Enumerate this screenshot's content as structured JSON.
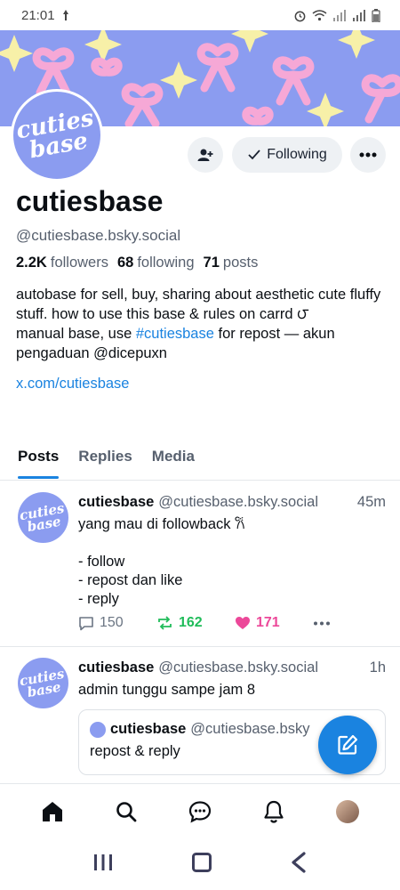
{
  "status_bar": {
    "time": "21:01"
  },
  "profile": {
    "avatar_text_line1": "cuties",
    "avatar_text_line2": "base",
    "display_name": "cutiesbase",
    "handle": "@cutiesbase.bsky.social",
    "followers_count": "2.2K",
    "followers_label": "followers",
    "following_count": "68",
    "following_label": "following",
    "posts_count": "71",
    "posts_label": "posts",
    "bio_line1": "autobase for sell, buy, sharing about aesthetic cute fluffy stuff. how to use this base & rules on carrd ౮",
    "bio_line2_prefix": "manual base, use ",
    "bio_hashtag": "#cutiesbase",
    "bio_line2_suffix": " for repost —  akun pengaduan @dicepuxn",
    "bio_link": "x.com/cutiesbase"
  },
  "actions": {
    "following_label": "Following"
  },
  "tabs": [
    {
      "label": "Posts",
      "active": true
    },
    {
      "label": "Replies",
      "active": false
    },
    {
      "label": "Media",
      "active": false
    }
  ],
  "posts": [
    {
      "name": "cutiesbase",
      "handle": "@cutiesbase.bsky.social",
      "time": "45m",
      "text_line1": "yang mau di followback 𐙚",
      "text_line2": "",
      "text_line3": "- follow",
      "text_line4": "- repost dan like",
      "text_line5": "- reply",
      "replies": "150",
      "reposts": "162",
      "likes": "171"
    },
    {
      "name": "cutiesbase",
      "handle": "@cutiesbase.bsky.social",
      "time": "1h",
      "text": "admin tunggu sampe jam 8",
      "quote": {
        "name": "cutiesbase",
        "handle": "@cutiesbase.bsky",
        "text": "repost & reply"
      }
    }
  ],
  "colors": {
    "accent": "#1a83e0",
    "repost": "#20bc5a",
    "like": "#ec4899",
    "banner": "#8b9cf0"
  },
  "icons": {
    "nav": [
      "home-icon",
      "search-icon",
      "chat-icon",
      "bell-icon",
      "profile-avatar"
    ],
    "system": [
      "recents-icon",
      "home-square-icon",
      "back-icon"
    ]
  }
}
